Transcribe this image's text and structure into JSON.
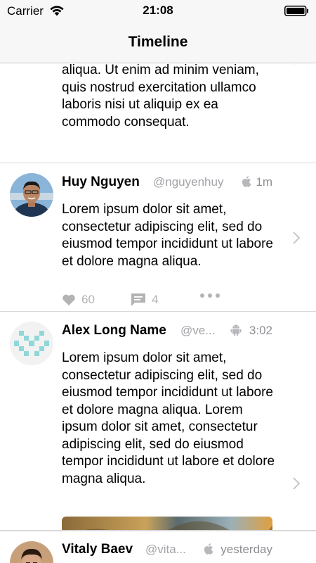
{
  "status_bar": {
    "carrier": "Carrier",
    "time": "21:08"
  },
  "nav": {
    "title": "Timeline"
  },
  "cells": [
    {
      "body": "aliqua. Ut enim ad minim veniam, quis nostrud exercitation ullamco laboris nisi ut aliquip ex ea commodo consequat."
    },
    {
      "name": "Huy Nguyen",
      "handle": "@nguyenhuy",
      "platform_icon": "apple-icon",
      "time": "1m",
      "body": "Lorem ipsum dolor sit amet, consectetur adipiscing elit, sed do eiusmod tempor incididunt ut labore et dolore magna aliqua.",
      "likes": "60",
      "comments": "4"
    },
    {
      "name": "Alex Long Name",
      "handle": "@ve...",
      "platform_icon": "android-icon",
      "time": "3:02",
      "body": "Lorem ipsum dolor sit amet, consectetur adipiscing elit, sed do eiusmod tempor incididunt ut labore et dolore magna aliqua. Lorem ipsum dolor sit amet, consectetur adipiscing elit, sed do eiusmod tempor incididunt ut labore et dolore magna aliqua."
    },
    {
      "name": "Vitaly Baev",
      "handle": "@vita...",
      "platform_icon": "apple-icon",
      "time": "yesterday"
    }
  ],
  "colors": {
    "bar_background": "#f7f7f7",
    "secondary_text": "#8e8e93",
    "action_gray": "#b3b3b3",
    "separator": "#d8d8d8",
    "identicon": "#8fd8d8"
  }
}
